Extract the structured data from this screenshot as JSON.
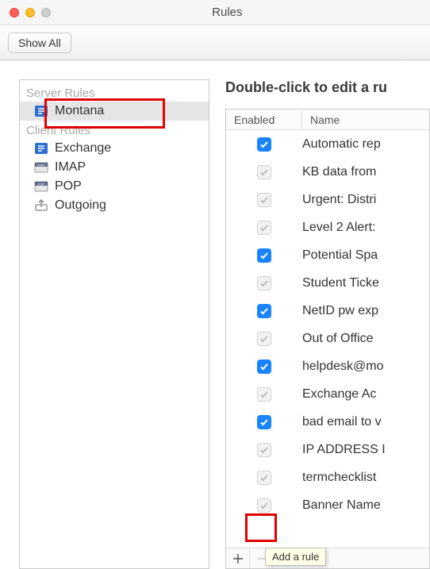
{
  "window": {
    "title": "Rules"
  },
  "toolbar": {
    "show_all": "Show All"
  },
  "sidebar": {
    "groups": [
      {
        "header": "Server Rules",
        "items": [
          {
            "label": "Montana",
            "icon": "exchange",
            "selected": true
          }
        ]
      },
      {
        "header": "Client Rules",
        "items": [
          {
            "label": "Exchange",
            "icon": "exchange",
            "selected": false
          },
          {
            "label": "IMAP",
            "icon": "imap",
            "selected": false
          },
          {
            "label": "POP",
            "icon": "pop",
            "selected": false
          },
          {
            "label": "Outgoing",
            "icon": "outgoing",
            "selected": false
          }
        ]
      }
    ]
  },
  "main": {
    "instruction": "Double-click to edit a ru",
    "columns": {
      "enabled": "Enabled",
      "name": "Name"
    },
    "rules": [
      {
        "enabled": true,
        "name": "Automatic rep"
      },
      {
        "enabled": false,
        "name": "KB data from"
      },
      {
        "enabled": false,
        "name": "Urgent: Distri"
      },
      {
        "enabled": false,
        "name": "Level 2 Alert:"
      },
      {
        "enabled": true,
        "name": "Potential Spa"
      },
      {
        "enabled": false,
        "name": "Student Ticke"
      },
      {
        "enabled": true,
        "name": "NetID pw exp"
      },
      {
        "enabled": false,
        "name": "Out of Office"
      },
      {
        "enabled": true,
        "name": "helpdesk@mo"
      },
      {
        "enabled": false,
        "name": "Exchange Ac"
      },
      {
        "enabled": true,
        "name": "bad email to v"
      },
      {
        "enabled": false,
        "name": "IP ADDRESS I"
      },
      {
        "enabled": false,
        "name": "termchecklist"
      },
      {
        "enabled": false,
        "name": "Banner Name"
      }
    ],
    "tooltip": "Add a rule"
  }
}
